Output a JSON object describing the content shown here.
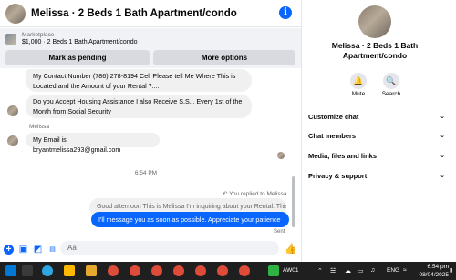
{
  "header": {
    "title": "Melissa · 2 Beds 1 Bath Apartment/condo"
  },
  "listing": {
    "label": "Marketplace",
    "price_title": "$1,000 · 2 Beds 1 Bath Apartment/condo",
    "mark_pending": "Mark as pending",
    "more_options": "More options"
  },
  "messages": {
    "m1_line1": "My Contact Number  (786) 278-8194 Cell  Please tell Me Where This is",
    "m1_line2": "Located and the Amount of your Rental  ?....",
    "m2_line1": "Do you Accept Housing Assistance  I also Receive S.S.i. Every 1st of the",
    "m2_line2": "Month from  Social  Security",
    "sender": "Melissa",
    "m3": "My Email is bryantmelissa293@gmail.com",
    "time": "6:54 PM",
    "replied_label": "You replied to Melissa",
    "quoted": "Good afternoon This is Melissa I'm inquiring about your Rental.  This is...",
    "outgoing": "I'll message you as soon as possible. Appreciate your patience",
    "status": "Sent"
  },
  "compose": {
    "placeholder": "Aa"
  },
  "panel": {
    "name_line1": "Melissa · 2 Beds 1 Bath",
    "name_line2": "Apartment/condo",
    "mute": "Mute",
    "search": "Search",
    "rows": [
      "Customize chat",
      "Chat members",
      "Media, files and links",
      "Privacy & support"
    ]
  },
  "taskbar": {
    "stock": "AW01",
    "lang": "ENG",
    "time": "6:54 pm",
    "date": "08/04/2025"
  },
  "colors": {
    "accent": "#0866ff",
    "bubble_in": "#f0f0f0",
    "taskbar": "#1f1f1f"
  },
  "icons": [
    "info-icon",
    "thumbs-up-icon",
    "bell-icon",
    "search-icon",
    "chevron-down-icon",
    "emoji-icon",
    "plus-icon",
    "image-icon",
    "sticker-icon",
    "gif-icon"
  ]
}
